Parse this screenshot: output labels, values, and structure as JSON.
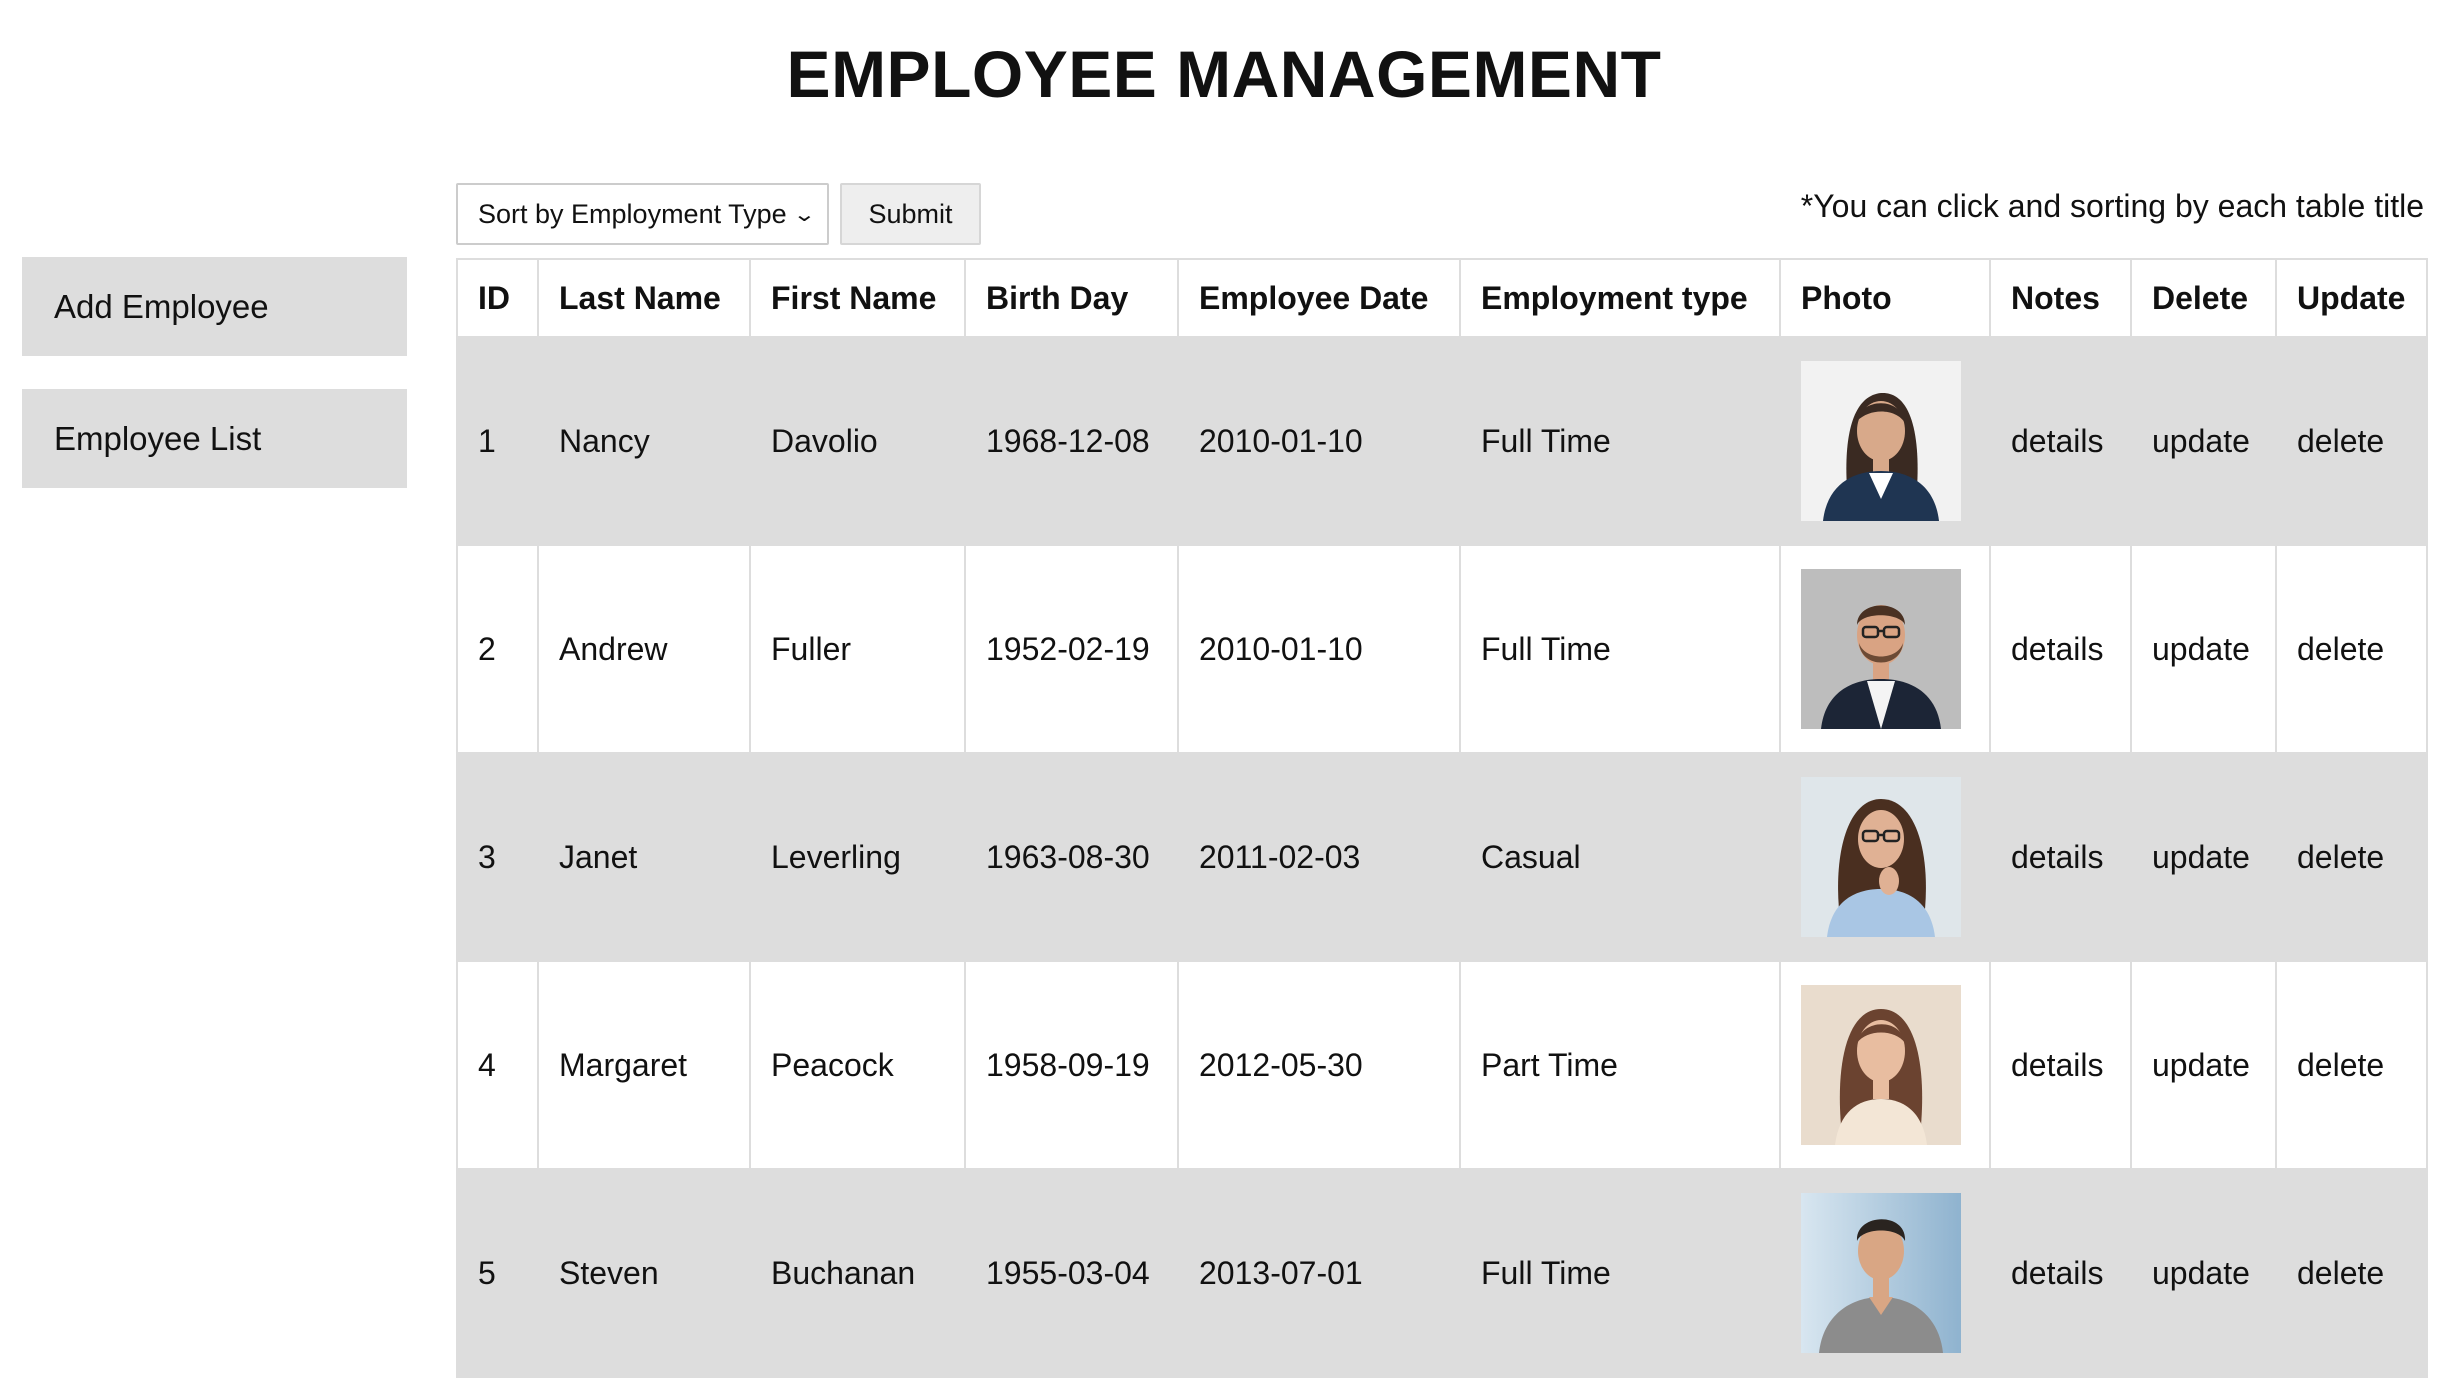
{
  "header": {
    "title": "EMPLOYEE MANAGEMENT"
  },
  "sidebar": {
    "items": [
      {
        "label": "Add Employee"
      },
      {
        "label": "Employee List"
      }
    ]
  },
  "controls": {
    "sort_select": {
      "value": "Sort by Employment Type"
    },
    "submit_label": "Submit",
    "hint": "*You can click and sorting by each table title"
  },
  "table": {
    "columns": [
      "ID",
      "Last Name",
      "First Name",
      "Birth Day",
      "Employee Date",
      "Employment type",
      "Photo",
      "Notes",
      "Delete",
      "Update"
    ],
    "rows": [
      {
        "id": "1",
        "last": "Nancy",
        "first": "Davolio",
        "birth": "1968-12-08",
        "hired": "2010-01-10",
        "type": "Full Time",
        "photo": "woman-dark-hair-blazer",
        "notes": "details",
        "delete": "update",
        "update": "delete"
      },
      {
        "id": "2",
        "last": "Andrew",
        "first": "Fuller",
        "birth": "1952-02-19",
        "hired": "2010-01-10",
        "type": "Full Time",
        "photo": "man-glasses-suit",
        "notes": "details",
        "delete": "update",
        "update": "delete"
      },
      {
        "id": "3",
        "last": "Janet",
        "first": "Leverling",
        "birth": "1963-08-30",
        "hired": "2011-02-03",
        "type": "Casual",
        "photo": "woman-glasses-curly-hair",
        "notes": "details",
        "delete": "update",
        "update": "delete"
      },
      {
        "id": "4",
        "last": "Margaret",
        "first": "Peacock",
        "birth": "1958-09-19",
        "hired": "2012-05-30",
        "type": "Part Time",
        "photo": "woman-long-brown-hair",
        "notes": "details",
        "delete": "update",
        "update": "delete"
      },
      {
        "id": "5",
        "last": "Steven",
        "first": "Buchanan",
        "birth": "1955-03-04",
        "hired": "2013-07-01",
        "type": "Full Time",
        "photo": "man-grey-tshirt",
        "notes": "details",
        "delete": "update",
        "update": "delete"
      }
    ]
  }
}
